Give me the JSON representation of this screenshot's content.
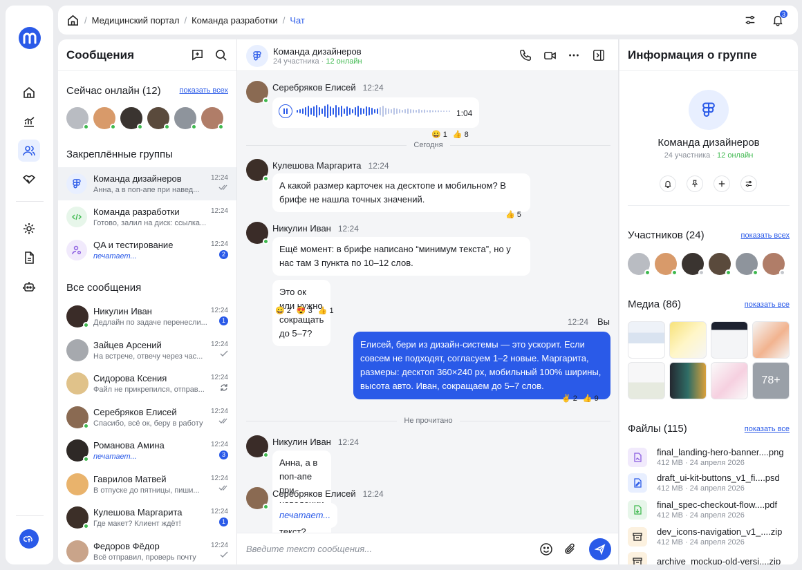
{
  "breadcrumb": {
    "items": [
      "Медицинский портал",
      "Команда разработки"
    ],
    "current": "Чат"
  },
  "notifications": {
    "count": "3"
  },
  "messages_panel": {
    "title": "Сообщения",
    "online": {
      "title": "Сейчас онлайн (12)",
      "link": "показать всех"
    },
    "pinned_title": "Закреплённые группы",
    "pinned": [
      {
        "name": "Команда дизайнеров",
        "time": "12:24",
        "preview": "Анна, а в поп-апе при навед..."
      },
      {
        "name": "Команда разработки",
        "time": "12:24",
        "preview": "Готово, залил на диск: ссылка..."
      },
      {
        "name": "QA и тестирование",
        "time": "12:24",
        "preview": "печатает...",
        "count": "2"
      }
    ],
    "all_title": "Все сообщения",
    "all": [
      {
        "name": "Никулин Иван",
        "time": "12:24",
        "preview": "Дедлайн по задаче перенесли...",
        "count": "1"
      },
      {
        "name": "Зайцев Арсений",
        "time": "12:24",
        "preview": "На встрече, отвечу через час..."
      },
      {
        "name": "Сидорова Ксения",
        "time": "12:24",
        "preview": "Файл не прикрепился, отправ..."
      },
      {
        "name": "Серебряков Елисей",
        "time": "12:24",
        "preview": "Спасибо, всё ок, беру в работу"
      },
      {
        "name": "Романова Амина",
        "time": "12:24",
        "preview": "печатает...",
        "count": "3"
      },
      {
        "name": "Гаврилов Матвей",
        "time": "12:24",
        "preview": "В отпуске до пятницы, пиши..."
      },
      {
        "name": "Кулешова Маргарита",
        "time": "12:24",
        "preview": "Где макет? Клиент ждёт!",
        "count": "1"
      },
      {
        "name": "Федоров Фёдор",
        "time": "12:24",
        "preview": "Всё отправил, проверь почту"
      }
    ]
  },
  "chat": {
    "title": "Команда дизайнеров",
    "members": "24 участника",
    "online": "12 онлайн",
    "m1": {
      "author": "Серебряков Елисей",
      "time": "12:24",
      "duration": "1:04",
      "r1": "😀 1",
      "r2": "👍 8"
    },
    "sep_today": "Сегодня",
    "m2": {
      "author": "Кулешова Маргарита",
      "time": "12:24",
      "text": "А какой размер карточек на десктопе и мобильном? В брифе не нашла точных значений.",
      "r1": "👍 5"
    },
    "m3": {
      "author": "Никулин Иван",
      "time": "12:24",
      "text1": "Ещё момент: в брифе написано “минимум текста”, но у нас там 3 пункта по 10–12 слов.",
      "text2": "Это ок или нужно сокращать до 5–7?",
      "r1": "😀 2",
      "r2": "😍 3",
      "r3": "👍 1"
    },
    "mine": {
      "time": "12:24",
      "author": "Вы",
      "text": "Елисей, бери из дизайн-системы — это ускорит. Если совсем не подходят, согласуем 1–2 новые. Маргарита, размеры: десктоп 360×240 px, мобильный 100% ширины, высота авто. Иван, сокращаем до 5–7 слов.",
      "r1": "✌️ 2",
      "r2": "👍 9"
    },
    "sep_unread": "Не прочитано",
    "m4": {
      "author": "Никулин Иван",
      "time": "12:24",
      "text": "Анна, а в поп-апе при наведении какой текст?"
    },
    "m5": {
      "author": "Серебряков Елисей",
      "time": "12:24",
      "text": "печатает..."
    },
    "composer": {
      "placeholder": "Введите текст сообщения..."
    }
  },
  "info": {
    "title": "Информация о группе",
    "group_name": "Команда дизайнеров",
    "members": "24 участника",
    "online": "12 онлайн",
    "participants": {
      "title": "Участников (24)",
      "link": "показать всех"
    },
    "media": {
      "title": "Медиа (86)",
      "link": "показать все",
      "more": "78+"
    },
    "files": {
      "title": "Файлы (115)",
      "link": "показать все",
      "items": [
        {
          "name": "final_landing-hero-banner....png",
          "meta": "412 MB · 24 апреля 2026"
        },
        {
          "name": "draft_ui-kit-buttons_v1_fi....psd",
          "meta": "412 MB · 24 апреля 2026"
        },
        {
          "name": "final_spec-checkout-flow....pdf",
          "meta": "412 MB · 24 апреля 2026"
        },
        {
          "name": "dev_icons-navigation_v1_....zip",
          "meta": "412 MB · 24 апреля 2026"
        },
        {
          "name": "archive_mockup-old-versi....zip",
          "meta": ""
        }
      ]
    }
  },
  "colors": {
    "accent": "#2a5ae8",
    "online": "#3fb94f",
    "panel": "#ffffff",
    "bg": "#ebecef"
  }
}
